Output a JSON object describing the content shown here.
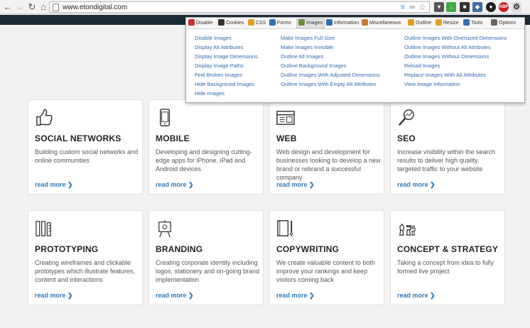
{
  "browser": {
    "url": "www.etondigital.com"
  },
  "extension_menu": {
    "tabs": [
      {
        "label": "Disable",
        "color": "#d62b2b"
      },
      {
        "label": "Cookies",
        "color": "#333333"
      },
      {
        "label": "CSS",
        "color": "#e0a020"
      },
      {
        "label": "Forms",
        "color": "#2f6fb5"
      },
      {
        "label": "Images",
        "color": "#6b8e3a"
      },
      {
        "label": "Information",
        "color": "#2f6fb5"
      },
      {
        "label": "Miscellaneous",
        "color": "#c77a2a"
      },
      {
        "label": "Outline",
        "color": "#e0a020"
      },
      {
        "label": "Resize",
        "color": "#e0a020"
      },
      {
        "label": "Tools",
        "color": "#2f6fb5"
      },
      {
        "label": "Options",
        "color": "#666666"
      }
    ],
    "col1": [
      "Disable Images",
      "Display Alt Attributes",
      "Display Image Dimensions",
      "Display Image Paths",
      "Find Broken Images",
      "Hide Background Images",
      "Hide Images"
    ],
    "col2": [
      "Make Images Full Size",
      "Make Images Invisible",
      "Outline All Images",
      "Outline Background Images",
      "Outline Images With Adjusted Dimensions",
      "Outline Images With Empty Alt Attributes"
    ],
    "col3": [
      "Outline Images With Oversized Dimensions",
      "Outline Images Without Alt Attributes",
      "Outline Images Without Dimensions",
      "Reload Images",
      "Replace Images With Alt Attributes",
      "View Image Information"
    ]
  },
  "cards": [
    {
      "title": "SOCIAL NETWORKS",
      "desc": "Building custom social networks and online communities",
      "more": "read more",
      "icon": "thumbs-up-icon"
    },
    {
      "title": "MOBILE",
      "desc": "Developing and designing cutting-edge apps for iPhone, iPad and Android devices",
      "more": "read more",
      "icon": "smartphone-icon"
    },
    {
      "title": "WEB",
      "desc": "Web design and development for businesses looking to develop a new brand or rebrand a successful company",
      "more": "read more",
      "icon": "browser-window-icon"
    },
    {
      "title": "SEO",
      "desc": "Increase visibility within the search results to deliver high quality, targeted traffic to your website",
      "more": "read more",
      "icon": "magnifier-chart-icon"
    },
    {
      "title": "PROTOTYPING",
      "desc": "Creating wireframes and clickable prototypes which illustrate features, content and interactions",
      "more": "read more",
      "icon": "pencil-ruler-icon"
    },
    {
      "title": "BRANDING",
      "desc": "Creating corporate identity including logos, stationery and on-going brand implementation",
      "more": "read more",
      "icon": "easel-icon"
    },
    {
      "title": "COPYWRITING",
      "desc": "We create valuable content to both improve your rankings and keep visitors coming back",
      "more": "read more",
      "icon": "notebook-pen-icon"
    },
    {
      "title": "CONCEPT & STRATEGY",
      "desc": "Taking a concept from idea to fully formed live project",
      "more": "read more",
      "icon": "chess-pieces-icon"
    }
  ]
}
